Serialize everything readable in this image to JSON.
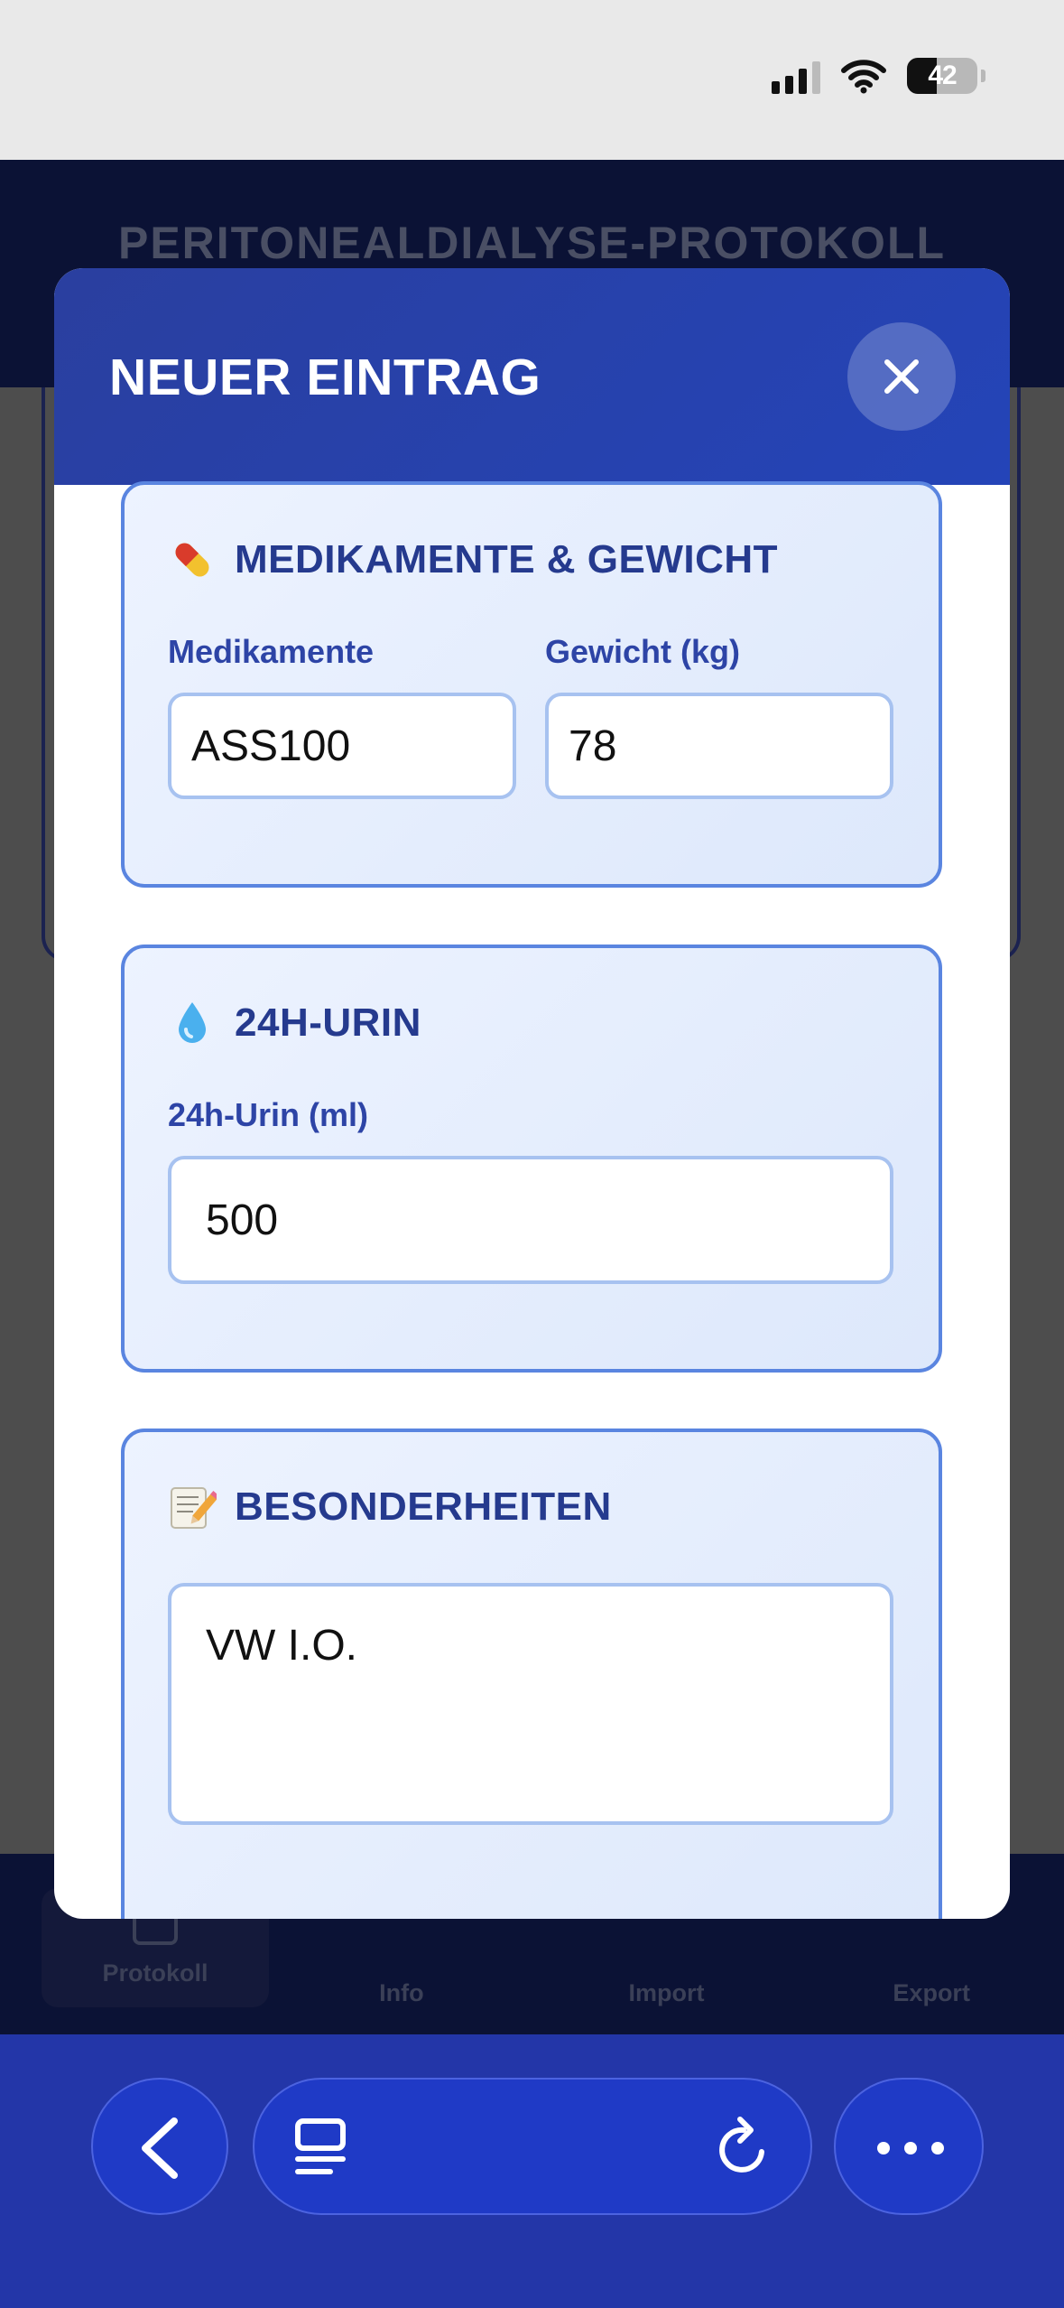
{
  "status_bar": {
    "battery_level": "42",
    "battery_fraction": 0.42,
    "signal_bars": 4
  },
  "app": {
    "header_title": "PERITONEALDIALYSE-PROTOKOLL",
    "tabs": [
      {
        "label": "Protokoll",
        "icon": "book-icon",
        "active": true
      },
      {
        "label": "Info",
        "icon": "info-icon",
        "active": false
      },
      {
        "label": "Import",
        "icon": "upload-icon",
        "active": false
      },
      {
        "label": "Export",
        "icon": "download-icon",
        "active": false
      }
    ]
  },
  "modal": {
    "title": "NEUER EINTRAG",
    "close_icon": "close-icon",
    "sections": {
      "meds_weight": {
        "emoji": "pill-icon",
        "title": "MEDIKAMENTE & GEWICHT",
        "meds_label": "Medikamente",
        "meds_value": "ASS100",
        "weight_label": "Gewicht (kg)",
        "weight_value": "78"
      },
      "urine": {
        "emoji": "droplet-icon",
        "title": "24H-URIN",
        "label": "24h-Urin (ml)",
        "value": "500"
      },
      "notes": {
        "emoji": "memo-icon",
        "title": "BESONDERHEITEN",
        "value": "VW I.O."
      }
    }
  },
  "browser": {
    "back_icon": "chevron-left-icon",
    "tabs_icon": "tabs-icon",
    "reload_icon": "reload-icon",
    "more_icon": "more-icon"
  },
  "colors": {
    "accent": "#2444b8",
    "section_border": "#5a85e0",
    "label": "#2d44a6",
    "app_dark": "#0b1235",
    "browser_bar": "#2336a8"
  }
}
